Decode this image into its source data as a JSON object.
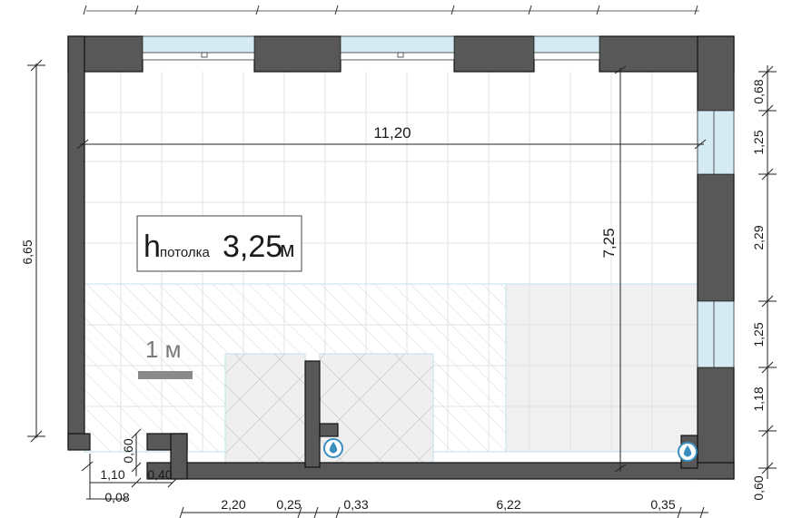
{
  "plan": {
    "ceiling_symbol": "h",
    "ceiling_sub": "потолка",
    "ceiling_value": "3,25",
    "ceiling_unit": "м",
    "scale_label": "1 м",
    "room_width": "11,20",
    "room_depth": "7,25",
    "left_height": "6,65"
  },
  "dims_right": [
    "0,68",
    "1,25",
    "2,29",
    "1,25",
    "1,18",
    "0,60"
  ],
  "dims_bottom": [
    "2,20",
    "0,25",
    "0,33",
    "6,22",
    "0,35"
  ],
  "dims_left_bottom": [
    "0,60",
    "1,10",
    "0,40",
    "0,08"
  ],
  "icons": {
    "water_1": "water-drop-icon",
    "water_2": "water-drop-icon"
  },
  "colors": {
    "wall": "#585858",
    "window": "#d4ebf3",
    "grid": "#e0e0e0",
    "zone": "#f0f0f0",
    "water": "#3a8fc0"
  }
}
